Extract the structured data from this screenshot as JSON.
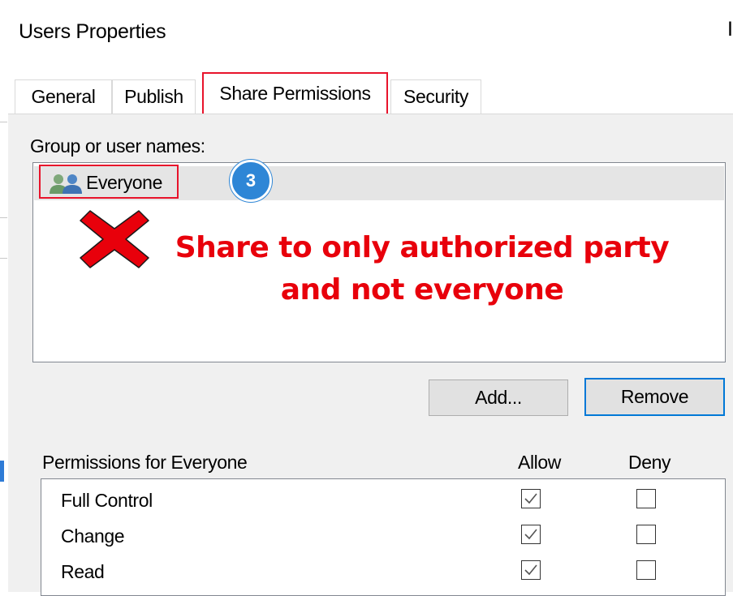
{
  "window": {
    "title": "Users Properties",
    "close_glyph": "I"
  },
  "tabs": [
    {
      "label": "General"
    },
    {
      "label": "Publish"
    },
    {
      "label": "Share Permissions",
      "active": true
    },
    {
      "label": "Security"
    }
  ],
  "group_list": {
    "label": "Group or user names:",
    "items": [
      {
        "name": "Everyone",
        "icon": "users-icon",
        "selected": true
      }
    ]
  },
  "annotation": {
    "step": "3",
    "mark": "red-x-icon",
    "line1": "Share to only authorized party",
    "line2": "and not everyone",
    "color": "#e8000b"
  },
  "buttons": {
    "add": "Add...",
    "remove": "Remove"
  },
  "permissions": {
    "label": "Permissions for Everyone",
    "allow_header": "Allow",
    "deny_header": "Deny",
    "rows": [
      {
        "name": "Full Control",
        "allow": true,
        "deny": false
      },
      {
        "name": "Change",
        "allow": true,
        "deny": false
      },
      {
        "name": "Read",
        "allow": true,
        "deny": false
      }
    ]
  },
  "colors": {
    "highlight": "#e8132b",
    "accent": "#0078d7",
    "badge": "#2e86d6"
  }
}
